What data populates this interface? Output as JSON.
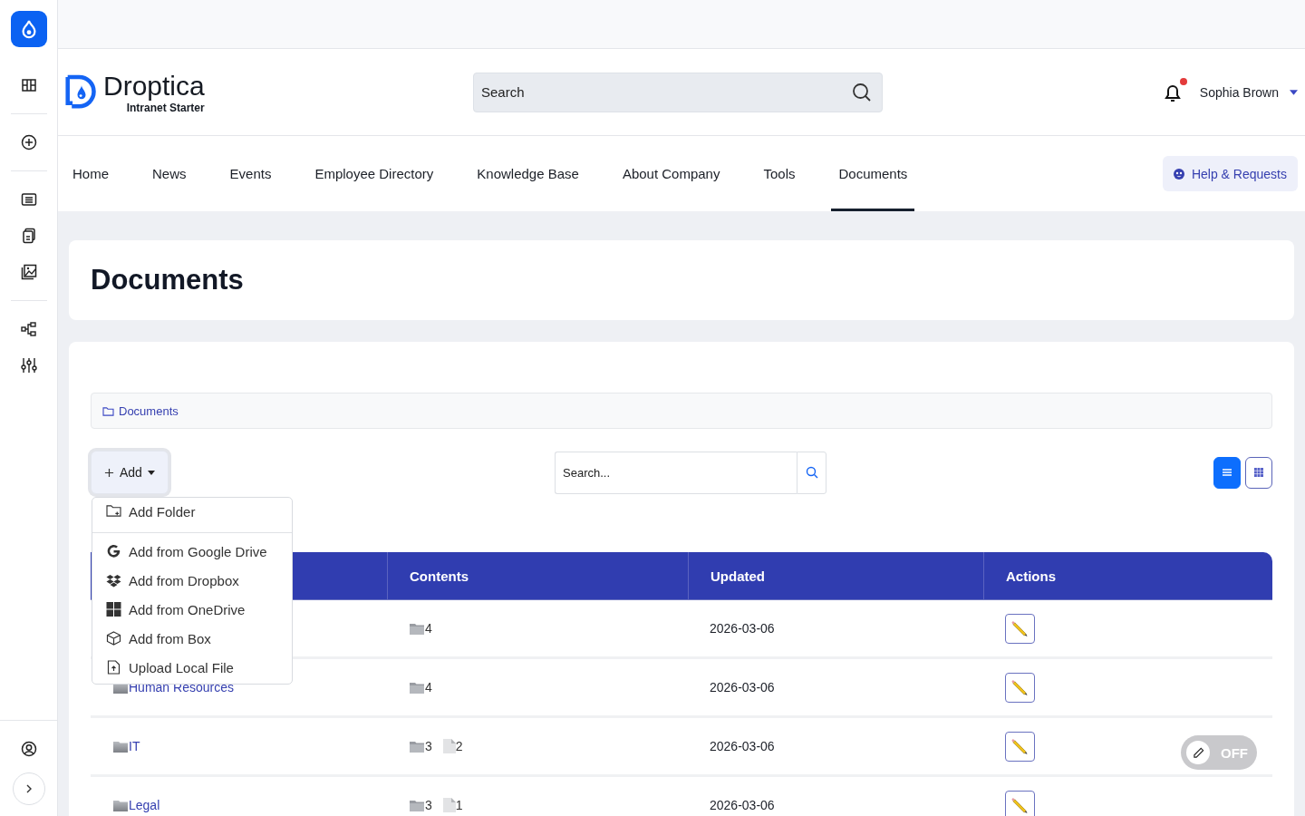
{
  "brand": {
    "name": "Droptica",
    "tagline": "Intranet Starter"
  },
  "search": {
    "placeholder": "Search"
  },
  "notifications": {
    "unread": true
  },
  "user": {
    "name": "Sophia Brown"
  },
  "nav": [
    {
      "label": "Home",
      "selected": false
    },
    {
      "label": "News",
      "selected": false
    },
    {
      "label": "Events",
      "selected": false
    },
    {
      "label": "Employee Directory",
      "selected": false
    },
    {
      "label": "Knowledge Base",
      "selected": false
    },
    {
      "label": "About Company",
      "selected": false
    },
    {
      "label": "Tools",
      "selected": false
    },
    {
      "label": "Documents",
      "selected": true
    }
  ],
  "help_button": "Help & Requests",
  "page_title": "Documents",
  "breadcrumb": "Documents",
  "add_button": "Add",
  "add_menu": {
    "expanded": true,
    "items": [
      {
        "kind": "folder",
        "label": "Add Folder"
      },
      {
        "kind": "google",
        "label": "Add from Google Drive"
      },
      {
        "kind": "dropbox",
        "label": "Add from Dropbox"
      },
      {
        "kind": "onedrive",
        "label": "Add from OneDrive"
      },
      {
        "kind": "box",
        "label": "Add from Box"
      },
      {
        "kind": "upload",
        "label": "Upload Local File"
      }
    ]
  },
  "file_search": {
    "placeholder": "Search..."
  },
  "view_modes": [
    {
      "kind": "list",
      "selected": true
    },
    {
      "kind": "grid",
      "selected": false
    }
  ],
  "table": {
    "columns": [
      "Contents",
      "Updated",
      "Actions"
    ],
    "rows": [
      {
        "folders": "4",
        "updated": "2026-03-06"
      },
      {
        "name": "Human Resources",
        "folders": "4",
        "updated": "2026-03-06"
      },
      {
        "name": "IT",
        "folders": "3",
        "files": "2",
        "updated": "2026-03-06"
      },
      {
        "name": "Legal",
        "folders": "3",
        "files": "1",
        "updated": "2026-03-06"
      }
    ]
  },
  "edit_toggle": {
    "on": false,
    "label": "OFF"
  }
}
